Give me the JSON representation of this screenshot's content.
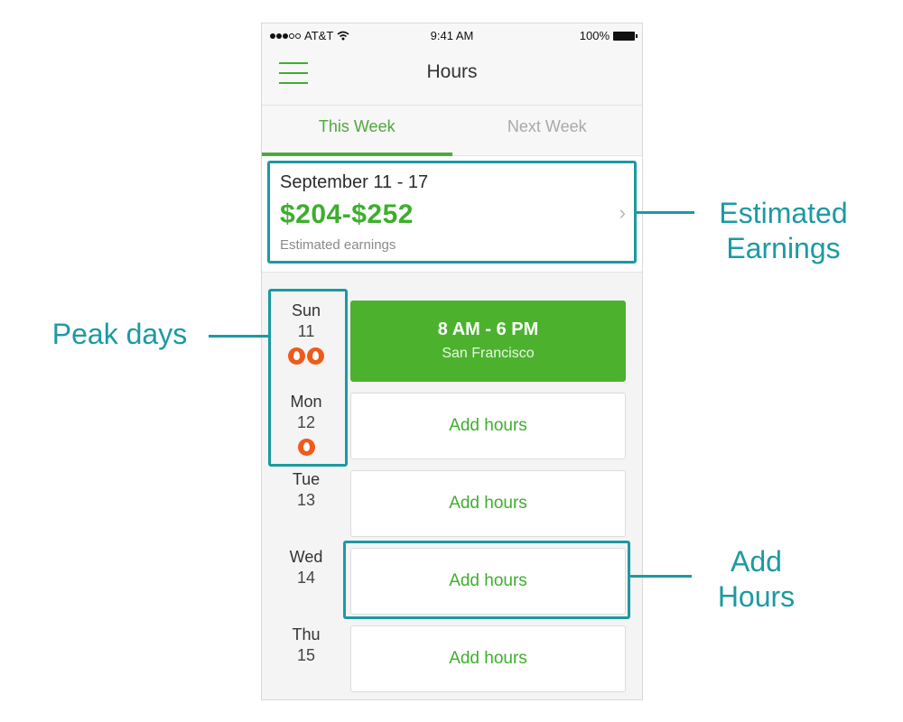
{
  "statusbar": {
    "carrier": "AT&T",
    "time": "9:41 AM",
    "battery": "100%",
    "signal_bars_filled": 3,
    "signal_bars_total": 5
  },
  "navbar": {
    "title": "Hours",
    "menu_icon": "hamburger-menu-icon"
  },
  "tabs": [
    {
      "label": "This Week",
      "active": true
    },
    {
      "label": "Next Week",
      "active": false
    }
  ],
  "summary": {
    "date_range": "September 11 - 17",
    "amount": "$204-$252",
    "label": "Estimated earnings",
    "chevron": "›"
  },
  "days": [
    {
      "name": "Sun",
      "num": "11",
      "peak": 2,
      "shift": {
        "time": "8 AM - 6 PM",
        "location": "San Francisco"
      }
    },
    {
      "name": "Mon",
      "num": "12",
      "peak": 1,
      "action": "Add hours"
    },
    {
      "name": "Tue",
      "num": "13",
      "peak": 0,
      "action": "Add hours"
    },
    {
      "name": "Wed",
      "num": "14",
      "peak": 0,
      "action": "Add hours"
    },
    {
      "name": "Thu",
      "num": "15",
      "peak": 0,
      "action": "Add hours"
    }
  ],
  "annotations": {
    "estimated_earnings": "Estimated Earnings",
    "peak_days": "Peak days",
    "add_hours": "Add Hours"
  },
  "colors": {
    "accent_green": "#3eae2d",
    "shift_green": "#4cb22e",
    "peak_orange": "#f05a1a",
    "annotation_teal": "#1b9aa3"
  }
}
